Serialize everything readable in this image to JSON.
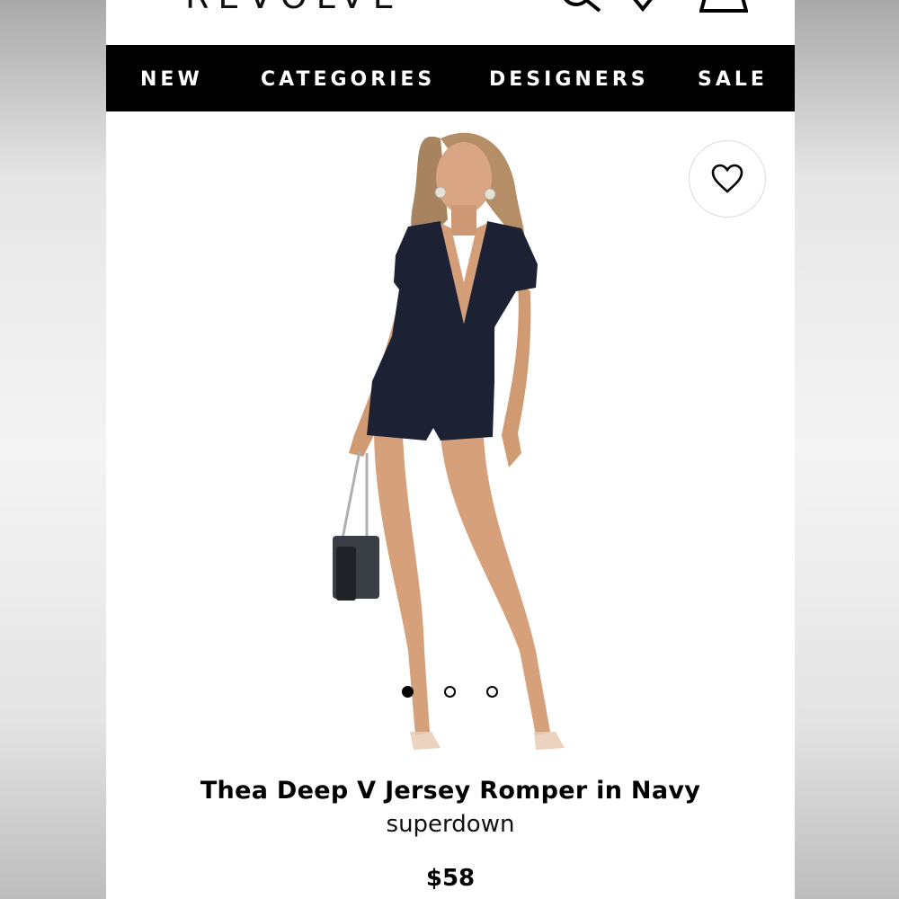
{
  "header": {
    "logo": "REVOLVE",
    "menu_icon": "menu-icon",
    "search_icon": "search-icon",
    "wishlist_icon": "heart-icon",
    "cart_icon": "shopping-bag-icon"
  },
  "nav": {
    "items": [
      {
        "label": "NEW"
      },
      {
        "label": "CATEGORIES"
      },
      {
        "label": "DESIGNERS"
      },
      {
        "label": "SALE"
      }
    ]
  },
  "product": {
    "title": "Thea Deep V Jersey Romper in Navy",
    "brand": "superdown",
    "price": "$58",
    "image_count": 3,
    "active_image": 1,
    "garment_color": "#1c2233"
  },
  "colors": {
    "nav_bg": "#000000",
    "nav_text": "#ffffff"
  }
}
